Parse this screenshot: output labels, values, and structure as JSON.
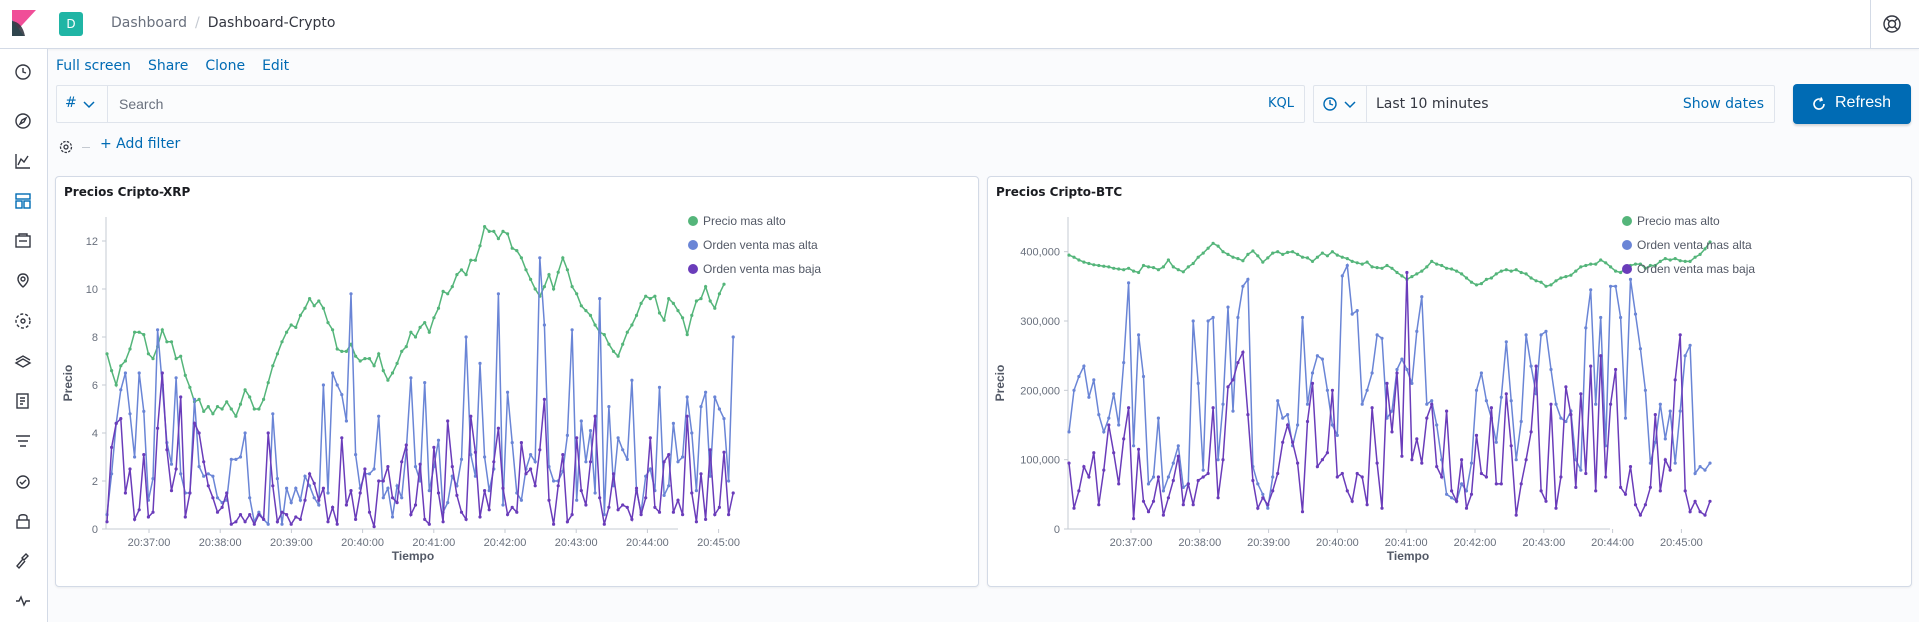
{
  "header": {
    "space_initial": "D",
    "breadcrumbs": [
      "Dashboard",
      "Dashboard-Crypto"
    ]
  },
  "nav": {
    "items": [
      "recent",
      "discover",
      "visualize",
      "dashboard",
      "canvas",
      "maps",
      "ml",
      "infrastructure",
      "logs",
      "apm",
      "uptime",
      "siem",
      "dev-tools",
      "monitoring"
    ],
    "active": "dashboard"
  },
  "menu": {
    "full_screen": "Full screen",
    "share": "Share",
    "clone": "Clone",
    "edit": "Edit"
  },
  "query": {
    "language_symbol": "#",
    "placeholder": "Search",
    "language": "KQL"
  },
  "time": {
    "label": "Last 10 minutes",
    "show_dates": "Show dates",
    "refresh": "Refresh"
  },
  "filters": {
    "add_filter": "+ Add filter"
  },
  "colors": {
    "accent": "#006bb4",
    "series_high": "#54b57a",
    "series_sell_high": "#6a85d6",
    "series_sell_low": "#6a3cba"
  },
  "chart_data": [
    {
      "type": "line",
      "title": "Precios Cripto-XRP",
      "xlabel": "Tiempo",
      "ylabel": "Precio",
      "x_ticks": [
        "20:37:00",
        "20:38:00",
        "20:39:00",
        "20:40:00",
        "20:41:00",
        "20:42:00",
        "20:43:00",
        "20:44:00",
        "20:45:00"
      ],
      "y_ticks": [
        "0",
        "2",
        "4",
        "6",
        "8",
        "10",
        "12"
      ],
      "ylim": [
        0,
        13
      ],
      "legend_position": "top-right",
      "series": [
        {
          "name": "Precio mas alto",
          "values": [
            7.3,
            6.6,
            6.0,
            6.8,
            7.0,
            7.5,
            8.2,
            8.2,
            8.1,
            7.3,
            7.1,
            7.6,
            8.3,
            7.8,
            7.8,
            7.1,
            7.2,
            6.4,
            5.9,
            5.3,
            5.4,
            4.9,
            5.1,
            4.8,
            5.1,
            5.0,
            5.3,
            5.0,
            4.7,
            5.2,
            5.8,
            5.5,
            5.0,
            5.0,
            5.4,
            6.1,
            6.8,
            7.3,
            7.8,
            8.2,
            8.5,
            8.4,
            8.9,
            9.2,
            9.6,
            9.3,
            9.5,
            9.2,
            8.6,
            8.3,
            7.5,
            7.4,
            7.4,
            7.7,
            7.2,
            7.0,
            7.1,
            7.1,
            6.8,
            7.3,
            6.6,
            6.2,
            6.5,
            6.9,
            7.4,
            7.6,
            8.2,
            8.0,
            8.4,
            8.6,
            8.2,
            8.8,
            9.2,
            9.9,
            9.8,
            10.1,
            10.6,
            10.8,
            10.6,
            11.2,
            11.2,
            11.8,
            12.6,
            12.4,
            12.4,
            12.1,
            12.4,
            12.3,
            11.7,
            11.6,
            11.3,
            10.8,
            10.4,
            10.0,
            9.7,
            10.1,
            10.6,
            10.0,
            10.7,
            11.3,
            10.8,
            10.1,
            9.8,
            9.3,
            9.1,
            8.9,
            8.5,
            8.2,
            8.1,
            7.7,
            7.4,
            7.2,
            7.7,
            8.2,
            8.5,
            8.9,
            9.4,
            9.7,
            9.6,
            9.7,
            9.0,
            8.7,
            9.6,
            9.4,
            9.1,
            8.8,
            8.1,
            8.9,
            9.5,
            9.6,
            10.1,
            9.5,
            9.2,
            9.8,
            10.2
          ]
        },
        {
          "name": "Orden venta mas alta",
          "values": [
            0.6,
            2.3,
            4.4,
            5.8,
            6.5,
            4.8,
            3.0,
            6.5,
            4.9,
            1.2,
            2.1,
            8.3,
            6.0,
            3.6,
            2.7,
            6.3,
            2.3,
            1.5,
            1.5,
            5.4,
            2.6,
            2.2,
            2.3,
            2.2,
            1.3,
            1.1,
            1.2,
            2.9,
            2.9,
            3.0,
            4.0,
            1.3,
            0.3,
            0.7,
            0.4,
            0.2,
            4.8,
            2.1,
            0.2,
            1.7,
            1.1,
            1.7,
            1.2,
            2.2,
            1.8,
            1.3,
            1.0,
            6.0,
            1.5,
            6.5,
            6.0,
            5.6,
            4.5,
            9.8,
            3.1,
            1.7,
            2.3,
            2.3,
            2.5,
            4.7,
            1.3,
            1.7,
            0.5,
            1.8,
            1.3,
            3.3,
            6.3,
            2.6,
            2.0,
            6.1,
            1.6,
            2.6,
            3.7,
            0.7,
            1.1,
            2.2,
            1.8,
            2.9,
            8.0,
            3.1,
            2.2,
            6.9,
            3.0,
            1.6,
            2.5,
            9.8,
            1.0,
            5.7,
            3.6,
            1.5,
            1.2,
            2.5,
            3.1,
            2.8,
            11.3,
            8.5,
            2.6,
            2.0,
            2.0,
            2.4,
            3.9,
            8.3,
            1.2,
            4.5,
            2.8,
            4.1,
            1.5,
            9.6,
            0.6,
            5.1,
            1.8,
            3.8,
            3.3,
            2.9,
            6.2,
            1.6,
            0.7,
            2.2,
            2.5,
            1.6,
            5.9,
            1.4,
            1.8,
            4.4,
            2.8,
            3.0,
            5.5,
            4.0,
            1.6,
            5.1,
            5.7,
            2.2,
            5.5,
            5.0,
            4.6,
            2.0,
            8.0
          ]
        },
        {
          "name": "Orden venta mas baja",
          "values": [
            0.3,
            3.4,
            4.4,
            4.6,
            1.5,
            2.5,
            0.4,
            0.8,
            3.1,
            0.5,
            0.7,
            4.2,
            6.5,
            3.3,
            1.6,
            2.5,
            5.5,
            0.5,
            1.5,
            4.4,
            4.0,
            2.8,
            1.8,
            1.3,
            0.7,
            0.9,
            1.5,
            0.2,
            0.3,
            0.6,
            0.3,
            0.6,
            0.2,
            0.6,
            0.4,
            4.0,
            1.8,
            0.3,
            0.7,
            0.6,
            0.2,
            0.5,
            0.4,
            1.2,
            2.3,
            1.9,
            1.2,
            1.7,
            0.3,
            0.9,
            0.2,
            3.8,
            1.0,
            1.6,
            0.4,
            1.5,
            2.5,
            0.7,
            0.1,
            2.0,
            2.0,
            2.6,
            1.3,
            1.1,
            2.8,
            3.5,
            0.6,
            1.0,
            2.7,
            0.4,
            0.2,
            3.4,
            1.5,
            0.3,
            4.5,
            2.6,
            1.4,
            0.7,
            0.4,
            4.7,
            3.2,
            0.5,
            1.6,
            0.8,
            2.8,
            4.2,
            1.7,
            0.6,
            0.9,
            0.7,
            3.6,
            2.3,
            2.5,
            1.8,
            3.3,
            5.4,
            1.2,
            0.2,
            1.8,
            3.1,
            0.3,
            0.6,
            3.8,
            1.6,
            1.0,
            2.8,
            4.7,
            1.3,
            0.2,
            0.9,
            2.3,
            0.8,
            1.0,
            0.9,
            0.4,
            1.7,
            0.6,
            1.3,
            3.8,
            0.9,
            0.7,
            2.8,
            3.1,
            0.7,
            1.2,
            0.6,
            4.7,
            1.5,
            0.3,
            2.3,
            0.4,
            3.3,
            0.6,
            0.9,
            3.2,
            0.6,
            1.5
          ]
        }
      ]
    },
    {
      "type": "line",
      "title": "Precios Cripto-BTC",
      "xlabel": "Tiempo",
      "ylabel": "Precio",
      "x_ticks": [
        "20:37:00",
        "20:38:00",
        "20:39:00",
        "20:40:00",
        "20:41:00",
        "20:42:00",
        "20:43:00",
        "20:44:00",
        "20:45:00"
      ],
      "y_ticks": [
        "0",
        "100,000",
        "200,000",
        "300,000",
        "400,000"
      ],
      "ylim": [
        0,
        450000
      ],
      "legend_position": "top-right",
      "series": [
        {
          "name": "Precio mas alto",
          "values": [
            395000,
            392000,
            388000,
            385000,
            383000,
            381000,
            380000,
            379000,
            378000,
            376000,
            375000,
            374000,
            376000,
            372000,
            370000,
            380000,
            378000,
            377000,
            374000,
            378000,
            388000,
            378000,
            374000,
            371000,
            378000,
            383000,
            392000,
            398000,
            405000,
            412000,
            408000,
            400000,
            396000,
            392000,
            390000,
            387000,
            396000,
            401000,
            394000,
            385000,
            391000,
            398000,
            400000,
            396000,
            399000,
            400000,
            396000,
            392000,
            391000,
            386000,
            392000,
            398000,
            394000,
            400000,
            395000,
            392000,
            390000,
            386000,
            384000,
            382000,
            385000,
            378000,
            377000,
            376000,
            380000,
            376000,
            370000,
            365000,
            360000,
            364000,
            368000,
            372000,
            378000,
            386000,
            382000,
            380000,
            376000,
            375000,
            372000,
            368000,
            362000,
            356000,
            352000,
            354000,
            360000,
            362000,
            368000,
            372000,
            374000,
            372000,
            374000,
            370000,
            368000,
            362000,
            358000,
            356000,
            350000,
            352000,
            358000,
            362000,
            364000,
            366000,
            372000,
            378000,
            380000,
            382000,
            382000,
            388000,
            384000,
            378000,
            372000,
            370000,
            376000,
            380000,
            382000,
            382000,
            376000,
            380000,
            380000,
            386000,
            390000,
            388000,
            390000,
            387000,
            386000,
            386000,
            392000,
            396000,
            404000,
            414000
          ]
        },
        {
          "name": "Orden venta mas alta",
          "values": [
            140000,
            200000,
            220000,
            235000,
            190000,
            215000,
            165000,
            140000,
            160000,
            195000,
            150000,
            240000,
            355000,
            120000,
            280000,
            220000,
            65000,
            75000,
            160000,
            55000,
            75000,
            95000,
            120000,
            60000,
            65000,
            300000,
            210000,
            85000,
            300000,
            305000,
            100000,
            180000,
            320000,
            170000,
            305000,
            350000,
            360000,
            90000,
            65000,
            50000,
            30000,
            75000,
            185000,
            160000,
            165000,
            120000,
            150000,
            305000,
            180000,
            225000,
            250000,
            245000,
            200000,
            150000,
            135000,
            365000,
            380000,
            310000,
            315000,
            180000,
            200000,
            225000,
            280000,
            275000,
            160000,
            170000,
            230000,
            245000,
            230000,
            210000,
            285000,
            335000,
            180000,
            185000,
            150000,
            100000,
            50000,
            45000,
            40000,
            65000,
            55000,
            95000,
            200000,
            225000,
            185000,
            160000,
            125000,
            190000,
            270000,
            185000,
            100000,
            155000,
            280000,
            235000,
            195000,
            280000,
            285000,
            230000,
            180000,
            160000,
            155000,
            170000,
            100000,
            85000,
            290000,
            345000,
            180000,
            305000,
            120000,
            350000,
            350000,
            305000,
            160000,
            360000,
            310000,
            260000,
            200000,
            95000,
            125000,
            180000,
            130000,
            170000,
            95000,
            170000,
            250000,
            265000,
            80000,
            90000,
            85000,
            95000
          ]
        },
        {
          "name": "Orden venta mas baja",
          "values": [
            95000,
            30000,
            55000,
            90000,
            75000,
            110000,
            35000,
            85000,
            150000,
            110000,
            65000,
            130000,
            175000,
            15000,
            115000,
            40000,
            25000,
            40000,
            75000,
            20000,
            45000,
            70000,
            105000,
            35000,
            65000,
            35000,
            70000,
            75000,
            80000,
            175000,
            45000,
            100000,
            205000,
            215000,
            240000,
            255000,
            165000,
            70000,
            30000,
            45000,
            35000,
            55000,
            80000,
            125000,
            150000,
            125000,
            95000,
            25000,
            155000,
            210000,
            90000,
            100000,
            110000,
            200000,
            75000,
            80000,
            55000,
            40000,
            80000,
            75000,
            35000,
            175000,
            95000,
            30000,
            210000,
            140000,
            225000,
            105000,
            370000,
            100000,
            130000,
            95000,
            160000,
            180000,
            90000,
            75000,
            170000,
            55000,
            40000,
            100000,
            30000,
            50000,
            135000,
            80000,
            75000,
            175000,
            65000,
            65000,
            195000,
            120000,
            20000,
            65000,
            100000,
            140000,
            235000,
            55000,
            40000,
            180000,
            30000,
            75000,
            205000,
            165000,
            60000,
            195000,
            80000,
            235000,
            55000,
            250000,
            75000,
            180000,
            230000,
            60000,
            50000,
            90000,
            35000,
            20000,
            35000,
            60000,
            165000,
            55000,
            100000,
            85000,
            215000,
            280000,
            55000,
            25000,
            40000,
            25000,
            20000,
            40000
          ]
        }
      ]
    }
  ]
}
